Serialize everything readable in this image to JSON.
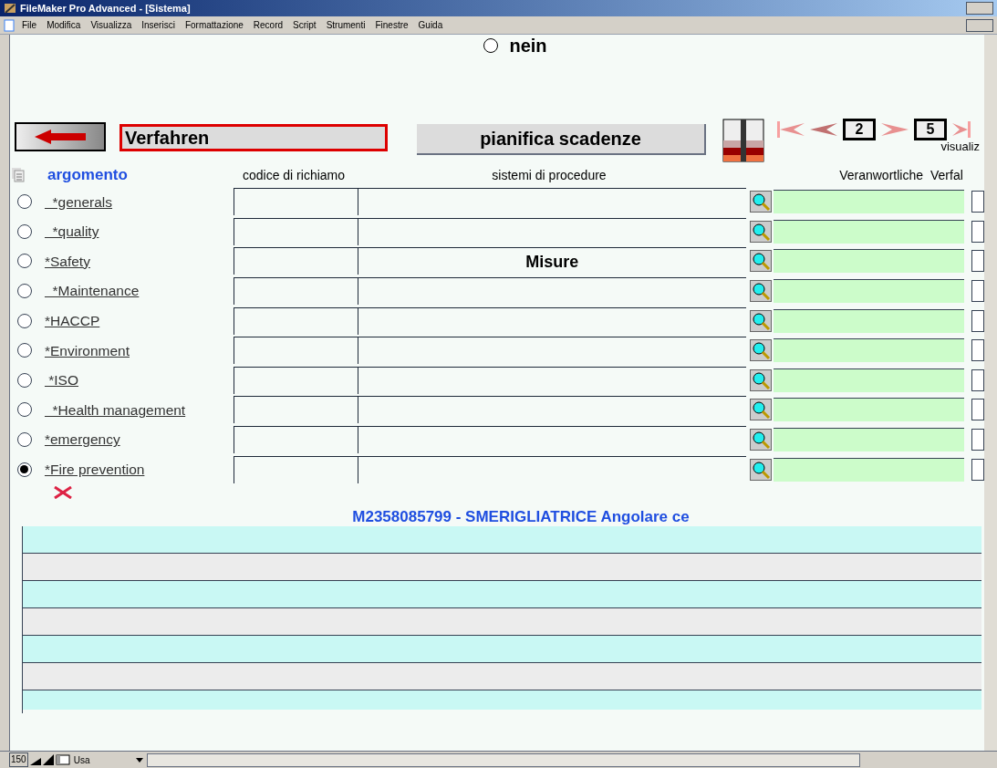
{
  "window": {
    "title": "FileMaker Pro Advanced - [Sistema]"
  },
  "menu": [
    "File",
    "Modifica",
    "Visualizza",
    "Inserisci",
    "Formattazione",
    "Record",
    "Script",
    "Strumenti",
    "Finestre",
    "Guida"
  ],
  "top_option": {
    "label": "nein",
    "selected": false
  },
  "layout_field": "Verfahren",
  "schedule_button": "pianifica scadenze",
  "pager": {
    "current": "2",
    "total": "5",
    "caption": "visualiz"
  },
  "headers": [
    "argomento",
    "codice di richiamo",
    "sistemi di procedure",
    "Veranwortliche",
    "Verfal"
  ],
  "topics": [
    {
      "label": "  *generals",
      "selected": false
    },
    {
      "label": "  *quality",
      "selected": false
    },
    {
      "label": "*Safety",
      "selected": false,
      "procedure": "Misure"
    },
    {
      "label": "  *Maintenance",
      "selected": false
    },
    {
      "label": "*HACCP",
      "selected": false
    },
    {
      "label": "*Environment",
      "selected": false
    },
    {
      "label": " *ISO",
      "selected": false
    },
    {
      "label": "  *Health management",
      "selected": false
    },
    {
      "label": "*emergency",
      "selected": false
    },
    {
      "label": "*Fire prevention",
      "selected": true
    }
  ],
  "machine_title": "M2358085799 - SMERIGLIATRICE Angolare ce",
  "status_bar": {
    "zoom": "150",
    "mode": "Usa"
  }
}
